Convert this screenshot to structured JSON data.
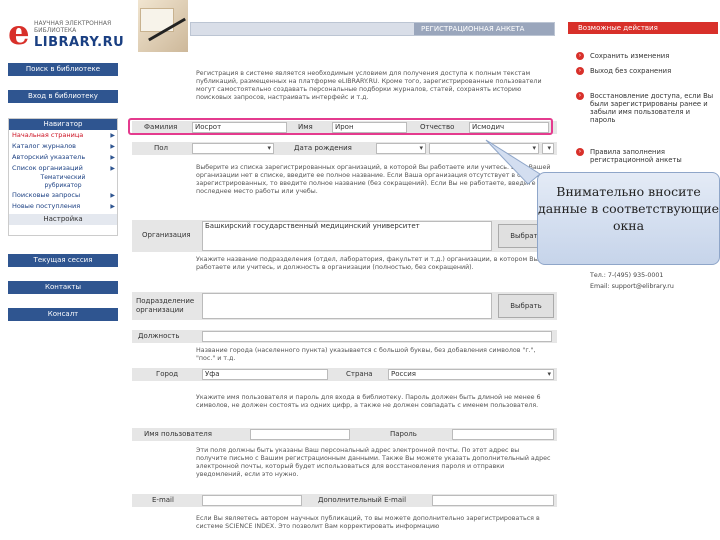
{
  "logo": {
    "letter": "e",
    "line1": "НАУЧНАЯ ЭЛЕКТРОННАЯ БИБЛИОТЕКА",
    "line2": "LIBRARY.RU"
  },
  "nav": {
    "search": "Поиск в библиотеке",
    "login": "Вход в библиотеку",
    "navigator": "Навигатор",
    "items": [
      {
        "label": "Начальная страница",
        "active": true
      },
      {
        "label": "Каталог журналов"
      },
      {
        "label": "Авторский указатель"
      },
      {
        "label": "Список организаций"
      },
      {
        "label": "Тематический рубрикатор"
      },
      {
        "label": "Поисковые запросы"
      },
      {
        "label": "Новые поступления"
      }
    ],
    "theme_line1": "Тематический",
    "theme_line2": "рубрикатор",
    "settings": "Настройка",
    "session": "Текущая сессия",
    "contacts": "Контакты",
    "support": "Консалт"
  },
  "topbar": {
    "title": "РЕГИСТРАЦИОННАЯ АНКЕТА"
  },
  "intro": "Регистрация в системе является необходимым условием для получения доступа к полным текстам публикаций, размещенных на платформе eLIBRARY.RU. Кроме того, зарегистрированные пользователи могут самостоятельно создавать персональные подборки журналов, статей, сохранять историю поисковых запросов, настраивать интерфейс и т.д.",
  "form": {
    "surname_label": "Фамилия",
    "surname_value": "Иосрот",
    "name_label": "Имя",
    "name_value": "Ирон",
    "patronymic_label": "Отчество",
    "patronymic_value": "Исмодич",
    "gender_label": "Пол",
    "birthdate_label": "Дата рождения",
    "org_text": "Выберите из списка зарегистрированных организаций, в которой Вы работаете или учитесь. Если Вашей организации нет в списке, введите ее полное название. Если Ваша организация отсутствует в списке зарегистрированных, то введите полное название (без сокращений). Если Вы не работаете, введите последнее место работы или учебы.",
    "org_label": "Организация",
    "org_value": "Башкирский государственный медицинский университет",
    "select_button": "Выбрать",
    "dept_text": "Укажите название подразделения (отдел, лаборатория, факультет и т.д.) организации, в котором Вы работаете или учитесь, и должность в организации (полностью, без сокращений).",
    "dept_label": "Подразделение организации",
    "position_label": "Должность",
    "city_text": "Название города (населенного пункта) указывается с большой буквы, без добавления символов \"г.\", \"пос.\" и т.д.",
    "city_label": "Город",
    "city_value": "Уфа",
    "country_label": "Страна",
    "country_value": "Россия",
    "password_text": "Укажите имя пользователя и пароль для входа в библиотеку. Пароль должен быть длиной не менее 6 символов, не должен состоять из одних цифр, а также не должен совпадать с именем пользователя.",
    "username_label": "Имя пользователя",
    "password_label": "Пароль",
    "email_text": "Эти поля должны быть указаны Ваш персональный адрес электронной почты. По этот адрес вы получите письмо с Вашим регистрационным данными. Также Вы можете указать дополнительный адрес электронной почты, который будет использоваться для восстановления пароля и отправки уведомлений, если это нужно.",
    "email_label": "E-mail",
    "extra_email_label": "Дополнительный E-mail",
    "science_text": "Если Вы являетесь автором научных публикаций, то вы можете дополнительно зарегистрироваться в системе SCIENCE INDEX. Это позволит Вам корректировать информацию"
  },
  "actions": {
    "header": "Возможные действия",
    "items": [
      "Сохранить изменения",
      "Выход без сохранения",
      "Восстановление доступа, если Вы были зарегистрированы ранее и забыли имя пользователя и пароль",
      "Правила заполнения регистрационной анкеты"
    ],
    "phone": "Тел.: 7-(495) 935-0001",
    "email": "Email: support@elibrary.ru"
  },
  "tooltip": {
    "text": "Внимательно вносите данные в соответствующие окна"
  }
}
